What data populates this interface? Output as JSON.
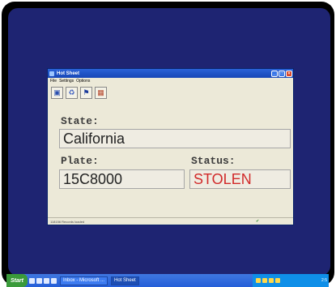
{
  "window": {
    "title": "Hot Sheet",
    "menu": [
      "File",
      "Settings",
      "Options"
    ],
    "toolbar_icons": [
      "save-icon",
      "recycle-icon",
      "flag-icon",
      "image-icon"
    ],
    "controls": {
      "minimize": "_",
      "maximize": "□",
      "close": "×"
    }
  },
  "fields": {
    "state_label": "State:",
    "state_value": "California",
    "plate_label": "Plate:",
    "plate_value": "15C8000",
    "status_label": "Status:",
    "status_value": "STOLEN"
  },
  "statusbar": {
    "text": "118156 Records loaded"
  },
  "colors": {
    "status_alert": "#d12a2a",
    "desktop": "#1e2472",
    "titlebar": "#1f54c4"
  },
  "taskbar": {
    "start_label": "Start",
    "tasks": [
      "Inbox - Microsoft ...",
      "Hot Sheet"
    ],
    "clock": "2:5"
  }
}
